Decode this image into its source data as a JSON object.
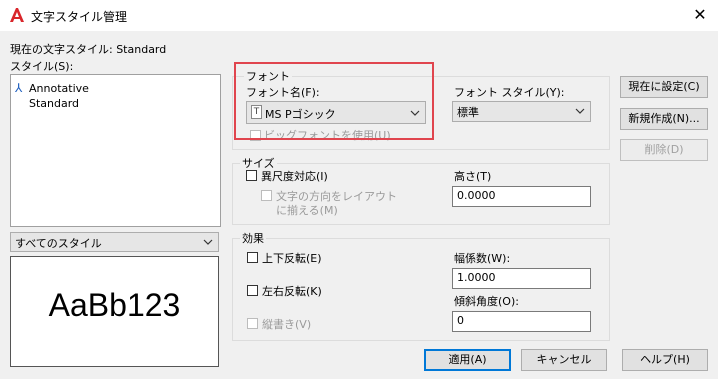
{
  "window": {
    "title": "文字スタイル管理",
    "close_glyph": "✕"
  },
  "current_style": {
    "label": "現在の文字スタイル: Standard"
  },
  "styles_list": {
    "label": "スタイル(S):",
    "items": [
      "Annotative",
      "Standard"
    ]
  },
  "filter": {
    "value": "すべてのスタイル"
  },
  "preview": {
    "text": "AaBb123"
  },
  "font_group": {
    "title": "フォント",
    "font_name_label": "フォント名(F):",
    "font_name_value": "MS Pゴシック",
    "font_style_label": "フォント スタイル(Y):",
    "font_style_value": "標準",
    "bigfont_label": "ビッグフォントを使用(U)"
  },
  "size_group": {
    "title": "サイズ",
    "annotative_label": "異尺度対応(I)",
    "match_orientation_label_1": "文字の方向をレイアウト",
    "match_orientation_label_2": "に揃える(M)",
    "height_label": "高さ(T)",
    "height_value": "0.0000"
  },
  "effects_group": {
    "title": "効果",
    "upside_down_label": "上下反転(E)",
    "backwards_label": "左右反転(K)",
    "vertical_label": "縦書き(V)",
    "width_factor_label": "幅係数(W):",
    "width_factor_value": "1.0000",
    "oblique_label": "傾斜角度(O):",
    "oblique_value": "0"
  },
  "buttons": {
    "set_current": "現在に設定(C)",
    "new": "新規作成(N)...",
    "delete": "削除(D)",
    "apply": "適用(A)",
    "cancel": "キャンセル",
    "help": "ヘルプ(H)"
  },
  "colors": {
    "highlight": "#e0454e",
    "accent": "#0078d7",
    "app_icon": "#d9262b"
  }
}
